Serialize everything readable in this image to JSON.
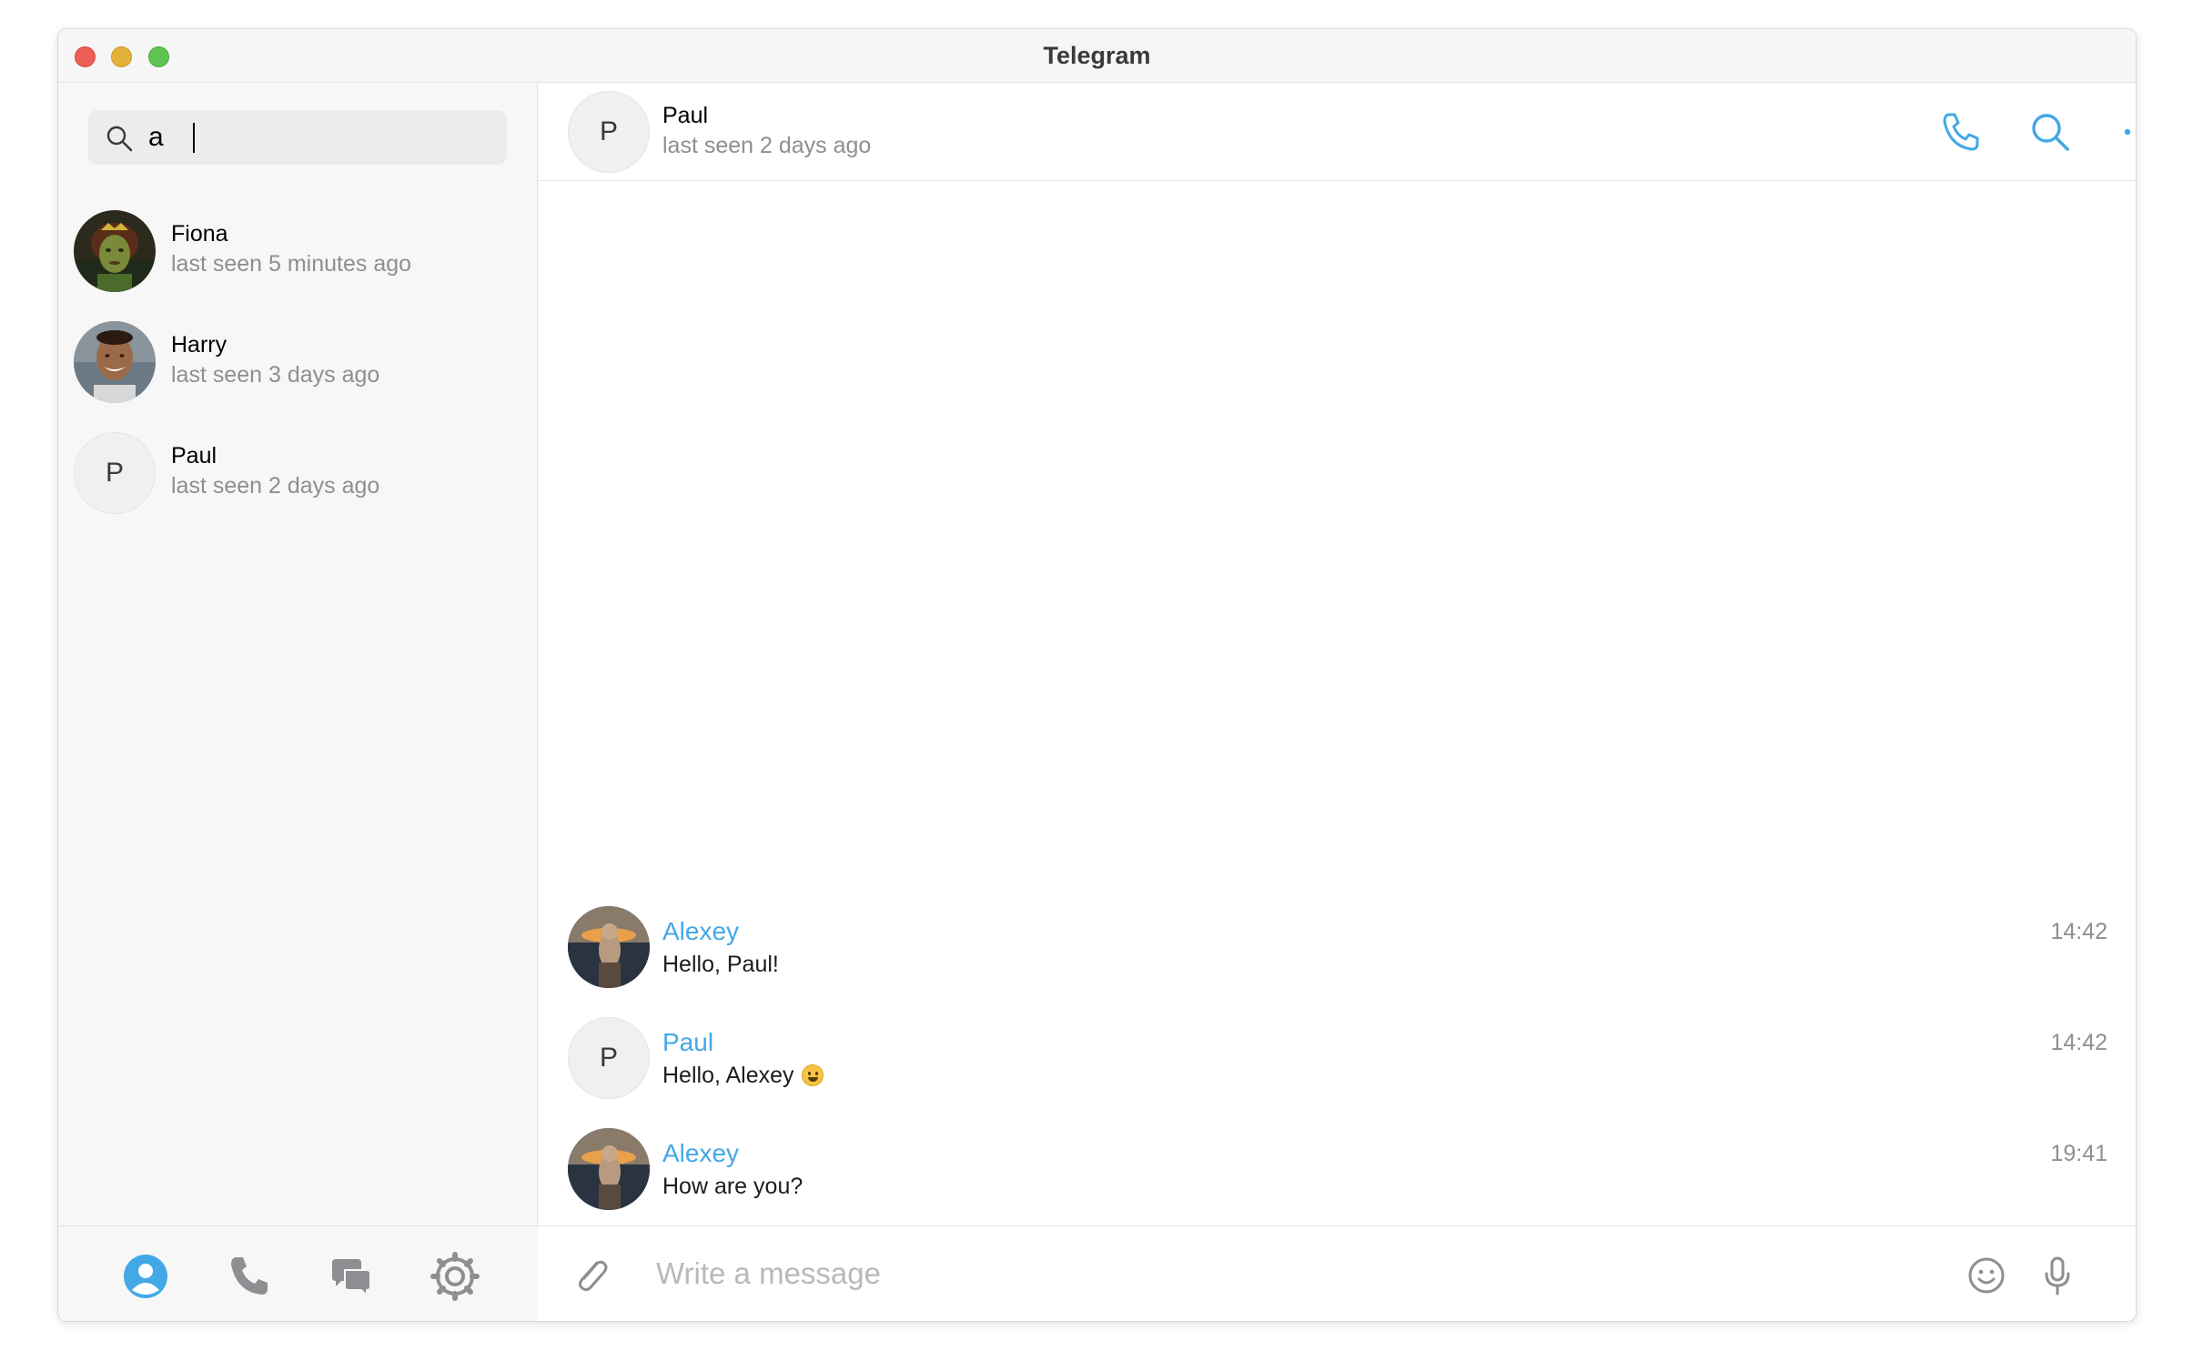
{
  "window": {
    "title": "Telegram"
  },
  "search": {
    "value": "a",
    "placeholder": ""
  },
  "contacts": [
    {
      "name": "Fiona",
      "status": "last seen 5 minutes ago",
      "avatar": "photo-ogre-woman"
    },
    {
      "name": "Harry",
      "status": "last seen 3 days ago",
      "avatar": "photo-smiling-man"
    },
    {
      "name": "Paul",
      "status": "last seen 2 days ago",
      "avatar_letter": "P"
    }
  ],
  "nav": {
    "items": [
      {
        "icon": "contacts-icon",
        "active": true
      },
      {
        "icon": "phone-icon",
        "active": false
      },
      {
        "icon": "chats-icon",
        "active": false
      },
      {
        "icon": "settings-icon",
        "active": false
      }
    ]
  },
  "chat": {
    "header": {
      "name": "Paul",
      "status": "last seen 2 days ago",
      "avatar_letter": "P"
    },
    "actions": [
      "phone-icon",
      "search-icon",
      "more-icon"
    ],
    "messages": [
      {
        "sender": "Alexey",
        "text": "Hello, Paul!",
        "time": "14:42",
        "avatar": "photo-person-sunset"
      },
      {
        "sender": "Paul",
        "text": "Hello, Alexey",
        "emoji": "grinning-face",
        "time": "14:42",
        "avatar_letter": "P"
      },
      {
        "sender": "Alexey",
        "text": "How are you?",
        "time": "19:41",
        "avatar": "photo-person-sunset"
      }
    ],
    "composer": {
      "placeholder": "Write a message",
      "value": ""
    }
  },
  "colors": {
    "accent": "#43a8e6",
    "muted": "#8e8e93"
  }
}
